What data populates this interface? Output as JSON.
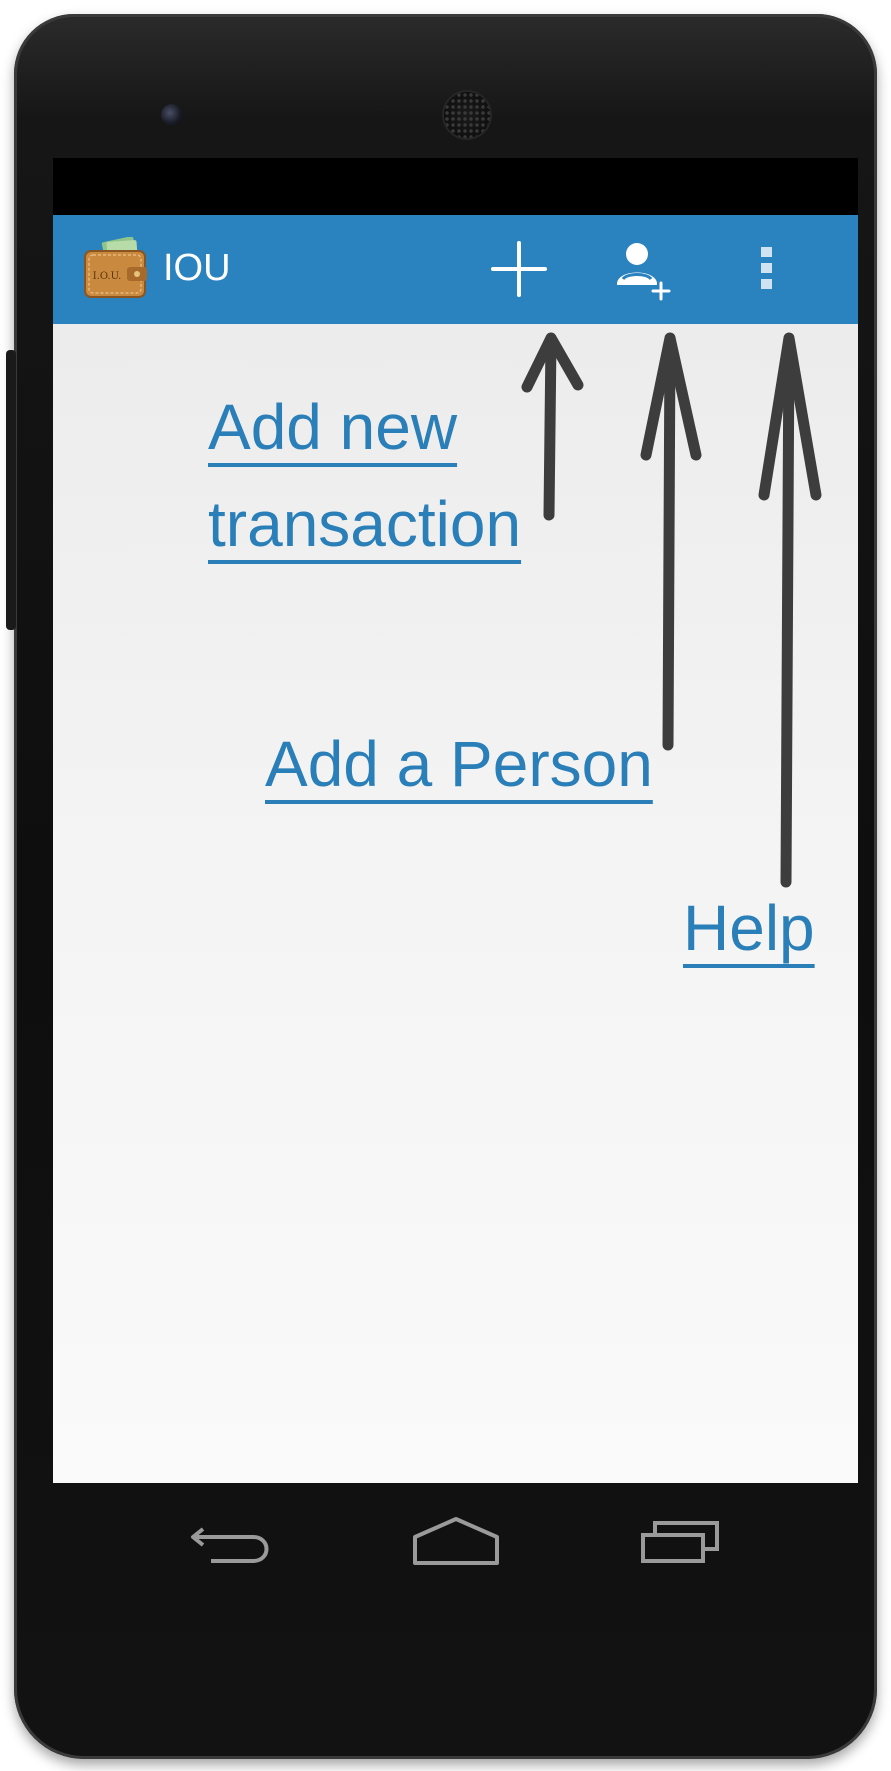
{
  "app": {
    "title": "IOU",
    "icon_name": "wallet-iou-icon",
    "icon_text": "I.O.U."
  },
  "action_bar": {
    "buttons": [
      {
        "name": "add-transaction-button",
        "icon": "plus-icon"
      },
      {
        "name": "add-person-button",
        "icon": "person-add-icon"
      },
      {
        "name": "overflow-menu-button",
        "icon": "more-vertical-icon"
      }
    ]
  },
  "callouts": {
    "add_transaction_line1": "Add new",
    "add_transaction_line2": "transaction",
    "add_person": "Add a Person",
    "help": "Help"
  },
  "nav_bar": {
    "buttons": [
      {
        "name": "back-button",
        "icon": "back-icon"
      },
      {
        "name": "home-button",
        "icon": "home-icon"
      },
      {
        "name": "recents-button",
        "icon": "recents-icon"
      }
    ]
  },
  "colors": {
    "action_bar": "#2a82bf",
    "callout_text": "#2a7fb8",
    "arrow": "#3d3d3d",
    "nav_icon": "#9a9a9a"
  }
}
